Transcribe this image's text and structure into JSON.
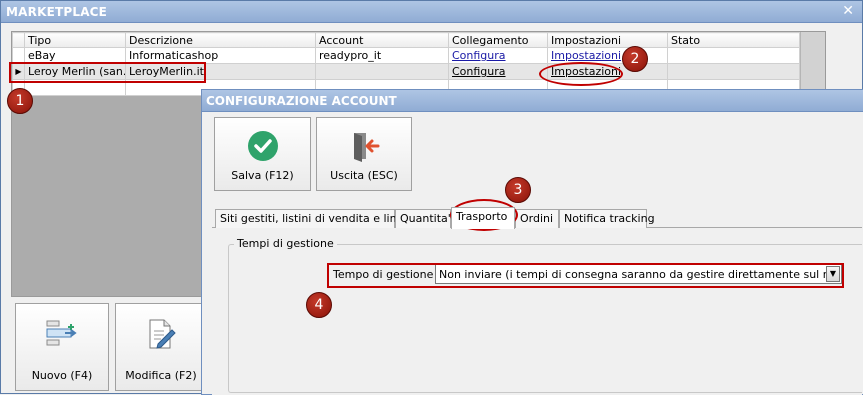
{
  "window": {
    "title": "MARKETPLACE",
    "close_glyph": "✕"
  },
  "grid": {
    "headers": [
      "Tipo",
      "Descrizione",
      "Account",
      "Collegamento",
      "Impostazioni",
      "Stato"
    ],
    "rows": [
      {
        "tipo": "eBay",
        "descrizione": "Informaticashop",
        "account": "readypro_it",
        "collegamento": "Configura",
        "impostazioni": "Impostazioni",
        "stato": ""
      },
      {
        "tipo": "Leroy Merlin (san...",
        "descrizione": "LeroyMerlin.it",
        "account": "",
        "collegamento": "Configura",
        "impostazioni": "Impostazioni",
        "stato": ""
      }
    ],
    "row_indicator": "▶"
  },
  "main_buttons": {
    "nuovo": {
      "label": "Nuovo (F4)",
      "icon": "new-record-icon"
    },
    "modifica": {
      "label": "Modifica (F2)",
      "icon": "edit-document-icon"
    }
  },
  "dialog": {
    "title": "CONFIGURAZIONE ACCOUNT",
    "buttons": {
      "salva": {
        "label": "Salva (F12)",
        "icon": "check-circle-icon"
      },
      "uscita": {
        "label": "Uscita (ESC)",
        "icon": "exit-door-icon"
      }
    },
    "tabs": [
      {
        "label": "Siti gestiti, listini di vendita e lingue",
        "active": false
      },
      {
        "label": "Quantita'",
        "active": false
      },
      {
        "label": "Trasporto",
        "active": true
      },
      {
        "label": "Ordini",
        "active": false
      },
      {
        "label": "Notifica tracking",
        "active": false
      }
    ],
    "group": {
      "legend": "Tempi di gestione"
    },
    "field": {
      "label": "Tempo di gestione :",
      "value": "Non inviare (i tempi di consegna saranno da gestire direttamente sul marketplace)"
    }
  },
  "annotations": {
    "badges": [
      "1",
      "2",
      "3",
      "4"
    ],
    "color": "#c00000"
  },
  "colors": {
    "titlebar": "#9db7dc",
    "check_green": "#2fa36b",
    "exit_red": "#e0522f"
  }
}
